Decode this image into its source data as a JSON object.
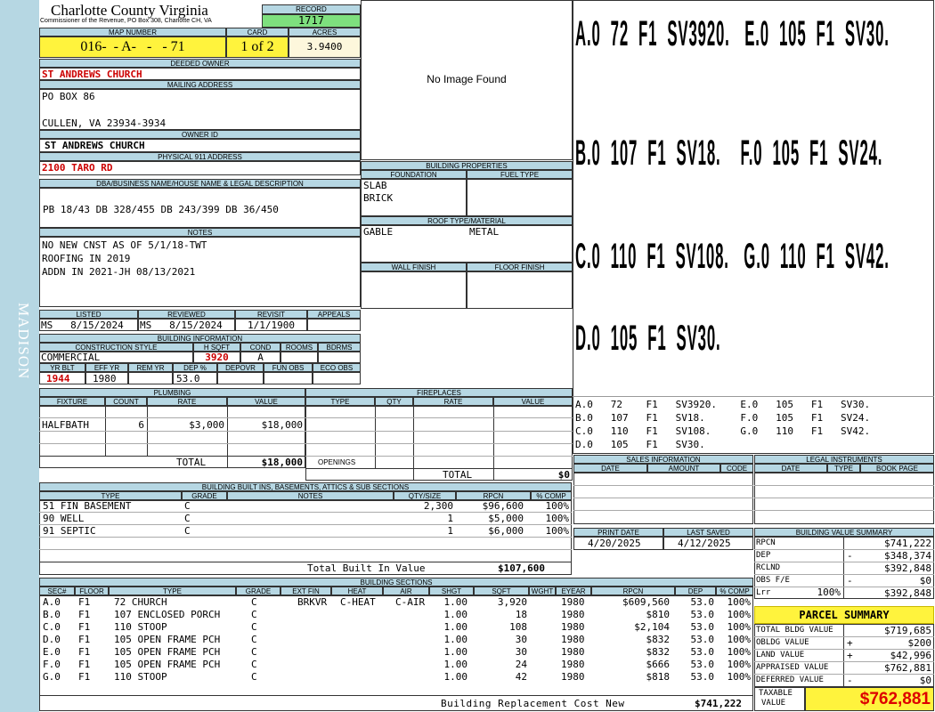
{
  "county": {
    "title": "Charlotte County Virginia",
    "subtitle": "Commissioner of the Revenue, PO Box 308, Charlotte CH, VA"
  },
  "record": {
    "label": "RECORD",
    "value": "1717"
  },
  "map": {
    "label": "MAP NUMBER",
    "value": "016-  - A-   -   - 71"
  },
  "card": {
    "label": "CARD",
    "value": "1 of 2"
  },
  "acres": {
    "label": "ACRES",
    "value": "3.9400"
  },
  "side_label": "MADISON",
  "deeded_owner": {
    "label": "DEEDED OWNER",
    "value": "ST ANDREWS CHURCH"
  },
  "mailing": {
    "label": "MAILING ADDRESS",
    "line1": "PO BOX 86",
    "line2": "CULLEN, VA 23934-3934"
  },
  "owner_id": {
    "label": "OWNER ID",
    "value": "ST ANDREWS CHURCH"
  },
  "physical": {
    "label": "PHYSICAL 911 ADDRESS",
    "value": "2100 TARO RD"
  },
  "legal": {
    "label": "DBA/BUSINESS NAME/HOUSE NAME & LEGAL DESCRIPTION",
    "value": "PB 18/43 DB 328/455 DB 243/399 DB 36/450"
  },
  "notes": {
    "label": "NOTES",
    "lines": [
      "NO NEW CNST AS OF 5/1/18-TWT",
      "ROOFING IN 2019",
      "ADDN IN 2021-JH 08/13/2021"
    ]
  },
  "image_missing": "No Image Found",
  "dates": {
    "listed_label": "LISTED",
    "listed": "MS   8/15/2024",
    "reviewed_label": "REVIEWED",
    "reviewed": "MS   8/15/2024",
    "revisit_label": "REVISIT",
    "revisit": "1/1/1900",
    "appeals_label": "APPEALS",
    "appeals": ""
  },
  "building_info": {
    "label": "BUILDING INFORMATION",
    "h_style": "CONSTRUCTION STYLE",
    "h_sqft": "H SQFT",
    "h_cond": "COND",
    "h_rooms": "ROOMS",
    "h_bdrms": "BDRMS",
    "style": "COMMERCIAL",
    "sqft": "3920",
    "cond": "A",
    "rooms": "",
    "bdrms": "",
    "h_yrblt": "YR BLT",
    "h_effyr": "EFF YR",
    "h_remyr": "REM YR",
    "h_dep": "DEP %",
    "h_depovr": "DEPOVR",
    "h_funobs": "FUN OBS",
    "h_ecoobs": "ECO OBS",
    "yrblt": "1944",
    "effyr": "1980",
    "remyr": "",
    "dep": "53.0",
    "depovr": "",
    "funobs": "",
    "ecoobs": ""
  },
  "building_props": {
    "label": "BUILDING PROPERTIES",
    "h_foundation": "FOUNDATION",
    "h_fuel": "FUEL TYPE",
    "foundation1": "SLAB",
    "foundation2": "BRICK",
    "fuel": "",
    "h_roof": "ROOF TYPE/MATERIAL",
    "roof_type": "GABLE",
    "roof_mat": "METAL",
    "h_wall": "WALL FINISH",
    "h_floor": "FLOOR FINISH",
    "wall": "",
    "floor": ""
  },
  "sketch": {
    "large": [
      "A.0  72  F1  SV3920.   E.0  105  F1  SV30.",
      "B.0  107  F1  SV18.    F.0  105  F1  SV24.",
      "C.0  110  F1  SV108.   G.0  110  F1  SV42.",
      "D.0  105  F1  SV30."
    ],
    "small": [
      "A.0   72    F1   SV3920.    E.0   105   F1   SV30.",
      "B.0   107   F1   SV18.      F.0   105   F1   SV24.",
      "C.0   110   F1   SV108.     G.0   110   F1   SV42.",
      "D.0   105   F1   SV30."
    ]
  },
  "plumbing": {
    "label": "PLUMBING",
    "headers": [
      "FIXTURE",
      "COUNT",
      "RATE",
      "VALUE"
    ],
    "rows": [
      {
        "fixture": "HALFBATH",
        "count": "6",
        "rate": "$3,000",
        "value": "$18,000"
      }
    ],
    "total_label": "TOTAL",
    "total": "$18,000"
  },
  "fireplaces": {
    "label": "FIREPLACES",
    "headers": [
      "TYPE",
      "QTY",
      "RATE",
      "VALUE"
    ],
    "openings_label": "OPENINGS",
    "total_label": "TOTAL",
    "total": "$0"
  },
  "builtins": {
    "label": "BUILDING BUILT INS, BASEMENTS, ATTICS & SUB SECTIONS",
    "headers": [
      "TYPE",
      "GRADE",
      "NOTES",
      "QTY/SIZE",
      "RPCN",
      "% COMP"
    ],
    "rows": [
      {
        "type": "51 FIN BASEMENT",
        "grade": "C",
        "notes": "",
        "qty": "2,300",
        "rpcn": "$96,600",
        "comp": "100%"
      },
      {
        "type": "90 WELL",
        "grade": "C",
        "notes": "",
        "qty": "1",
        "rpcn": "$5,000",
        "comp": "100%"
      },
      {
        "type": "91 SEPTIC",
        "grade": "C",
        "notes": "",
        "qty": "1",
        "rpcn": "$6,000",
        "comp": "100%"
      }
    ],
    "total_label": "Total Built In Value",
    "total": "$107,600"
  },
  "sales": {
    "label": "SALES INFORMATION",
    "headers": [
      "DATE",
      "AMOUNT",
      "CODE"
    ]
  },
  "legal_instr": {
    "label": "LEGAL INSTRUMENTS",
    "headers": [
      "DATE",
      "TYPE",
      "BOOK PAGE"
    ]
  },
  "print": {
    "print_label": "PRINT DATE",
    "print_date": "4/20/2025",
    "saved_label": "LAST SAVED",
    "saved_date": "4/12/2025"
  },
  "value_summary": {
    "label": "BUILDING VALUE SUMMARY",
    "rows": [
      {
        "label": "RPCN",
        "pct": "",
        "sign": "",
        "value": "$741,222"
      },
      {
        "label": "DEP",
        "pct": "",
        "sign": "-",
        "value": "$348,374"
      },
      {
        "label": "RCLND",
        "pct": "",
        "sign": "",
        "value": "$392,848"
      },
      {
        "label": "OBS F/E",
        "pct": "",
        "sign": "-",
        "value": "$0"
      },
      {
        "label": "Lrr",
        "pct": "100%",
        "sign": "",
        "value": "$392,848"
      }
    ]
  },
  "sections": {
    "label": "BUILDING SECTIONS",
    "headers": [
      "SEC#",
      "FLOOR",
      "TYPE",
      "GRADE",
      "EXT FIN",
      "HEAT",
      "AIR",
      "SHGT",
      "SQFT",
      "WGHT",
      "EYEAR",
      "RPCN",
      "DEP",
      "% COMP"
    ],
    "rows": [
      {
        "sec": "A.0",
        "floor": "F1",
        "type": "72 CHURCH",
        "grade": "C",
        "ext": "BRKVR",
        "heat": "C-HEAT",
        "air": "C-AIR",
        "shgt": "1.00",
        "sqft": "3,920",
        "wght": "",
        "eyear": "1980",
        "rpcn": "$609,560",
        "dep": "53.0",
        "comp": "100%"
      },
      {
        "sec": "B.0",
        "floor": "F1",
        "type": "107 ENCLOSED PORCH",
        "grade": "C",
        "ext": "",
        "heat": "",
        "air": "",
        "shgt": "1.00",
        "sqft": "18",
        "wght": "",
        "eyear": "1980",
        "rpcn": "$810",
        "dep": "53.0",
        "comp": "100%"
      },
      {
        "sec": "C.0",
        "floor": "F1",
        "type": "110 STOOP",
        "grade": "C",
        "ext": "",
        "heat": "",
        "air": "",
        "shgt": "1.00",
        "sqft": "108",
        "wght": "",
        "eyear": "1980",
        "rpcn": "$2,104",
        "dep": "53.0",
        "comp": "100%"
      },
      {
        "sec": "D.0",
        "floor": "F1",
        "type": "105 OPEN FRAME PCH",
        "grade": "C",
        "ext": "",
        "heat": "",
        "air": "",
        "shgt": "1.00",
        "sqft": "30",
        "wght": "",
        "eyear": "1980",
        "rpcn": "$832",
        "dep": "53.0",
        "comp": "100%"
      },
      {
        "sec": "E.0",
        "floor": "F1",
        "type": "105 OPEN FRAME PCH",
        "grade": "C",
        "ext": "",
        "heat": "",
        "air": "",
        "shgt": "1.00",
        "sqft": "30",
        "wght": "",
        "eyear": "1980",
        "rpcn": "$832",
        "dep": "53.0",
        "comp": "100%"
      },
      {
        "sec": "F.0",
        "floor": "F1",
        "type": "105 OPEN FRAME PCH",
        "grade": "C",
        "ext": "",
        "heat": "",
        "air": "",
        "shgt": "1.00",
        "sqft": "24",
        "wght": "",
        "eyear": "1980",
        "rpcn": "$666",
        "dep": "53.0",
        "comp": "100%"
      },
      {
        "sec": "G.0",
        "floor": "F1",
        "type": "110 STOOP",
        "grade": "C",
        "ext": "",
        "heat": "",
        "air": "",
        "shgt": "1.00",
        "sqft": "42",
        "wght": "",
        "eyear": "1980",
        "rpcn": "$818",
        "dep": "53.0",
        "comp": "100%"
      }
    ],
    "total_label": "Building Replacement Cost New",
    "total": "$741,222"
  },
  "parcel": {
    "label": "PARCEL SUMMARY",
    "rows": [
      {
        "label": "TOTAL BLDG VALUE",
        "sign": "",
        "value": "$719,685"
      },
      {
        "label": "OBLDG VALUE",
        "sign": "+",
        "value": "$200"
      },
      {
        "label": "LAND VALUE",
        "sign": "+",
        "value": "$42,996"
      },
      {
        "label": "APPRAISED VALUE",
        "sign": "",
        "value": "$762,881"
      },
      {
        "label": "DEFERRED VALUE",
        "sign": "-",
        "value": "$0"
      }
    ],
    "taxable_label1": "TAXABLE",
    "taxable_label2": "VALUE",
    "taxable": "$762,881"
  }
}
